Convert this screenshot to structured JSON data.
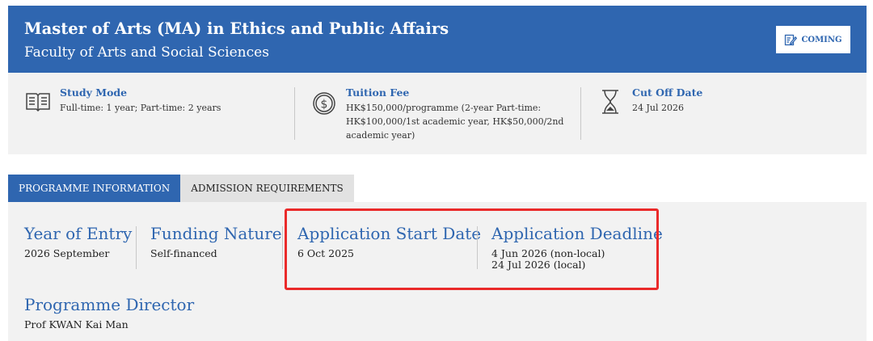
{
  "header": {
    "title": "Master of Arts (MA) in Ethics and Public Affairs",
    "subtitle": "Faculty of Arts and Social Sciences",
    "status_button": {
      "label": "COMING",
      "icon": "edit-icon"
    }
  },
  "summary": {
    "study_mode": {
      "label": "Study Mode",
      "value": "Full-time: 1 year; Part-time: 2 years",
      "icon": "book-icon"
    },
    "tuition_fee": {
      "label": "Tuition Fee",
      "value_lines": [
        "HK$150,000/programme (2-year Part-time:",
        "HK$100,000/1st academic year, HK$50,000/2nd",
        "academic year)"
      ],
      "icon": "dollar-coin-icon"
    },
    "cut_off_date": {
      "label": "Cut Off Date",
      "value": "24 Jul 2026",
      "icon": "hourglass-icon"
    }
  },
  "tabs": [
    {
      "label": "PROGRAMME INFORMATION",
      "active": true
    },
    {
      "label": "ADMISSION REQUIREMENTS",
      "active": false
    }
  ],
  "programme_info": {
    "year_of_entry": {
      "label": "Year of Entry",
      "value": "2026 September"
    },
    "funding_nature": {
      "label": "Funding Nature",
      "value": "Self-financed"
    },
    "application_start_date": {
      "label": "Application Start Date",
      "value": "6 Oct 2025"
    },
    "application_deadline": {
      "label": "Application Deadline",
      "values": [
        "4 Jun 2026 (non-local)",
        "24 Jul 2026 (local)"
      ]
    },
    "programme_director": {
      "label": "Programme Director",
      "value": "Prof KWAN Kai Man"
    }
  },
  "colors": {
    "brand_blue": "#2f66b0",
    "highlight_red": "#ea2a2a",
    "panel_grey": "#f2f2f2"
  }
}
